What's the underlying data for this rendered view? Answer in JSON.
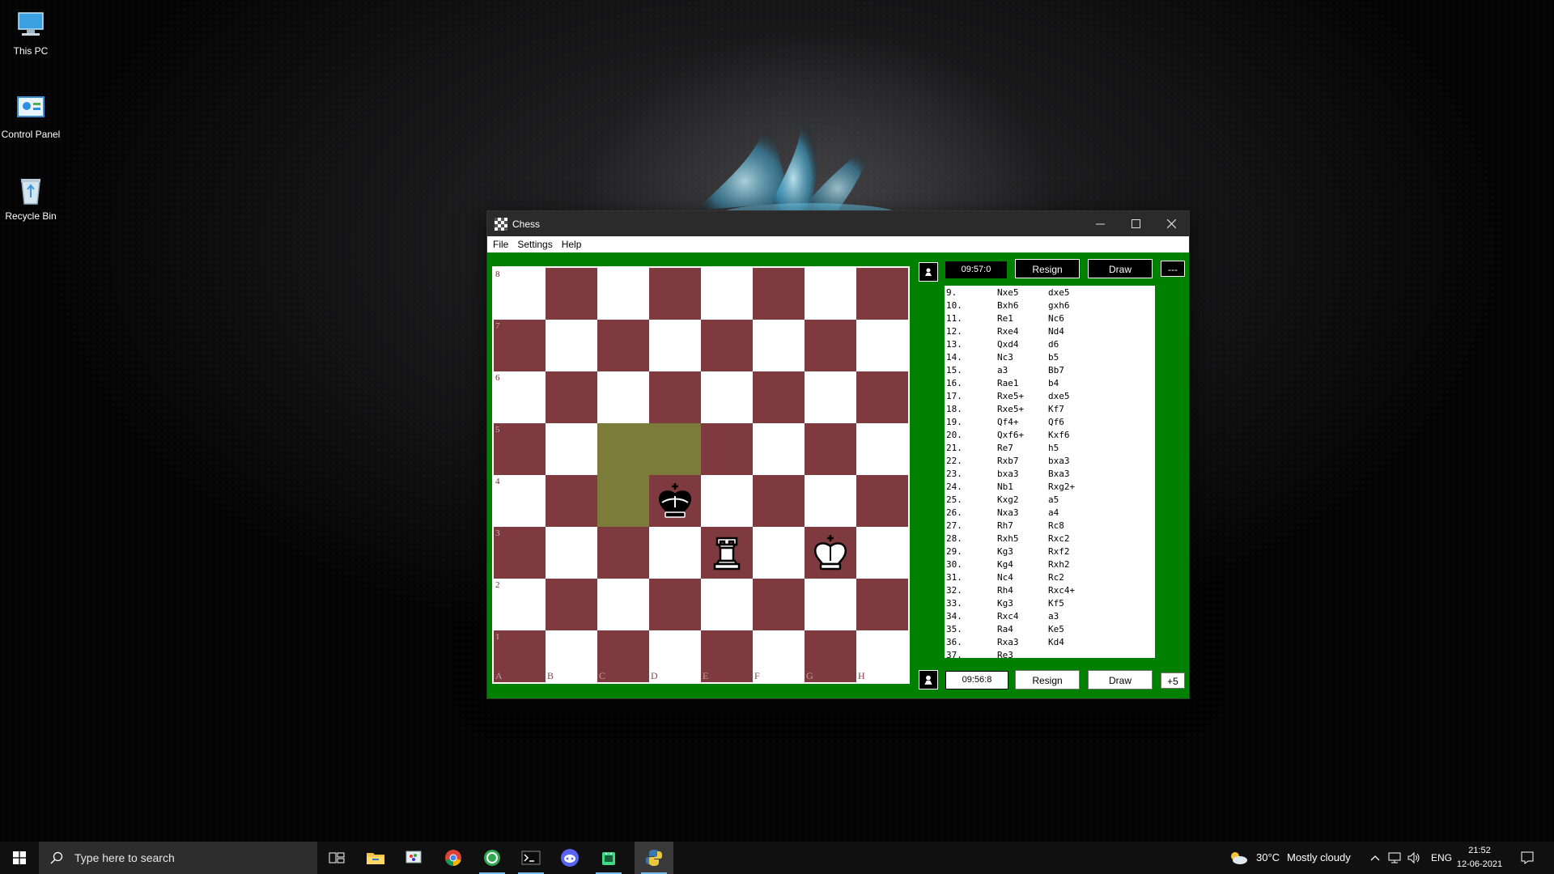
{
  "desktop": {
    "icons": [
      {
        "label": "This PC"
      },
      {
        "label": "Control Panel"
      },
      {
        "label": "Recycle Bin"
      }
    ]
  },
  "window": {
    "title": "Chess",
    "menu": [
      "File",
      "Settings",
      "Help"
    ]
  },
  "board": {
    "files": [
      "A",
      "B",
      "C",
      "D",
      "E",
      "F",
      "G",
      "H"
    ],
    "ranks": [
      "8",
      "7",
      "6",
      "5",
      "4",
      "3",
      "2",
      "1"
    ],
    "highlighted_squares": [
      "c5",
      "d5",
      "c4"
    ],
    "pieces": [
      {
        "square": "d4",
        "type": "king",
        "color": "black",
        "icon": "black-king-icon"
      },
      {
        "square": "e3",
        "type": "rook",
        "color": "white",
        "icon": "white-rook-icon"
      },
      {
        "square": "g3",
        "type": "king",
        "color": "white",
        "icon": "white-king-icon"
      }
    ],
    "colors": {
      "light": "#ffffff",
      "dark": "#7f3a3f",
      "highlight": "#7c7c3a",
      "frame": "#008000"
    }
  },
  "top_player": {
    "clock": "09:57:0",
    "resign_label": "Resign",
    "draw_label": "Draw",
    "score_label": "---"
  },
  "bottom_player": {
    "clock": "09:56:8",
    "resign_label": "Resign",
    "draw_label": "Draw",
    "score_label": "+5"
  },
  "moves": [
    {
      "num": "9.",
      "white": "Nxe5",
      "black": "dxe5"
    },
    {
      "num": "10.",
      "white": "Bxh6",
      "black": "gxh6"
    },
    {
      "num": "11.",
      "white": "Re1",
      "black": "Nc6"
    },
    {
      "num": "12.",
      "white": "Rxe4",
      "black": "Nd4"
    },
    {
      "num": "13.",
      "white": "Qxd4",
      "black": "d6"
    },
    {
      "num": "14.",
      "white": "Nc3",
      "black": "b5"
    },
    {
      "num": "15.",
      "white": "a3",
      "black": "Bb7"
    },
    {
      "num": "16.",
      "white": "Rae1",
      "black": "b4"
    },
    {
      "num": "17.",
      "white": "Rxe5+",
      "black": "dxe5"
    },
    {
      "num": "18.",
      "white": "Rxe5+",
      "black": "Kf7"
    },
    {
      "num": "19.",
      "white": "Qf4+",
      "black": "Qf6"
    },
    {
      "num": "20.",
      "white": "Qxf6+",
      "black": "Kxf6"
    },
    {
      "num": "21.",
      "white": "Re7",
      "black": "h5"
    },
    {
      "num": "22.",
      "white": "Rxb7",
      "black": "bxa3"
    },
    {
      "num": "23.",
      "white": "bxa3",
      "black": "Bxa3"
    },
    {
      "num": "24.",
      "white": "Nb1",
      "black": "Rxg2+"
    },
    {
      "num": "25.",
      "white": "Kxg2",
      "black": "a5"
    },
    {
      "num": "26.",
      "white": "Nxa3",
      "black": "a4"
    },
    {
      "num": "27.",
      "white": "Rh7",
      "black": "Rc8"
    },
    {
      "num": "28.",
      "white": "Rxh5",
      "black": "Rxc2"
    },
    {
      "num": "29.",
      "white": "Kg3",
      "black": "Rxf2"
    },
    {
      "num": "30.",
      "white": "Kg4",
      "black": "Rxh2"
    },
    {
      "num": "31.",
      "white": "Nc4",
      "black": "Rc2"
    },
    {
      "num": "32.",
      "white": "Rh4",
      "black": "Rxc4+"
    },
    {
      "num": "33.",
      "white": "Kg3",
      "black": "Kf5"
    },
    {
      "num": "34.",
      "white": "Rxc4",
      "black": "a3"
    },
    {
      "num": "35.",
      "white": "Ra4",
      "black": "Ke5"
    },
    {
      "num": "36.",
      "white": "Rxa3",
      "black": "Kd4"
    },
    {
      "num": "37.",
      "white": "Re3",
      "black": ""
    }
  ],
  "taskbar": {
    "search_placeholder": "Type here to search",
    "apps": [
      "task-view-icon",
      "file-explorer-icon",
      "paint-icon",
      "chrome-icon",
      "green-app-icon",
      "terminal-icon",
      "discord-icon",
      "android-icon",
      "python-icon"
    ],
    "weather": {
      "temp": "30°C",
      "condition": "Mostly cloudy"
    },
    "language": "ENG",
    "time": "21:52",
    "date": "12-06-2021"
  }
}
